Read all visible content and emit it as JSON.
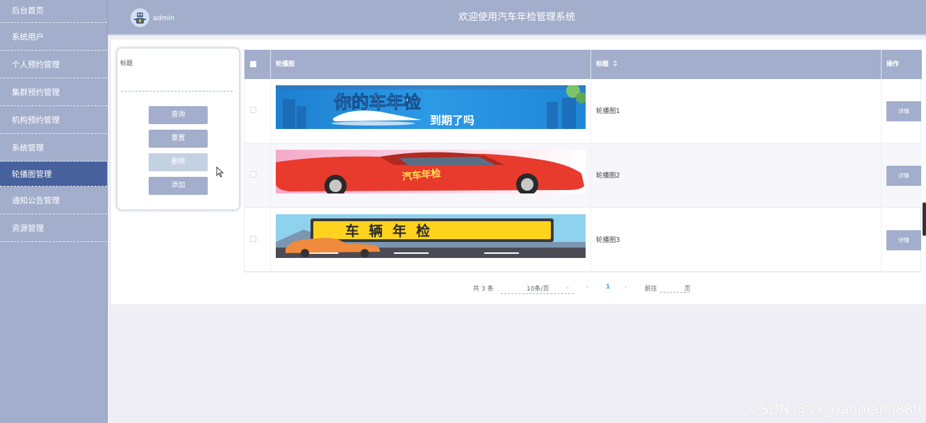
{
  "sidebar": {
    "items": [
      {
        "label": "后台首页"
      },
      {
        "label": "系统用户"
      },
      {
        "label": "个人预约管理"
      },
      {
        "label": "集群预约管理"
      },
      {
        "label": "机构预约管理"
      },
      {
        "label": "系统管理"
      },
      {
        "label": "轮播图管理"
      },
      {
        "label": "通知公告管理"
      },
      {
        "label": "资源管理"
      }
    ],
    "active": "轮播图管理"
  },
  "header": {
    "username": "admin",
    "title": "欢迎使用汽车年检管理系统"
  },
  "search": {
    "title_label": "标题",
    "title_value": "",
    "query_label": "查询",
    "reset_label": "重置",
    "delete_label": "删除",
    "add_label": "添加"
  },
  "table": {
    "columns": {
      "image": "轮播图",
      "title": "标题",
      "actions": "操作"
    },
    "rows": [
      {
        "banner_text_1": "你的车年检",
        "banner_text_2": "到期了吗",
        "title": "轮播图1",
        "action": "详情"
      },
      {
        "banner_text_1": "汽车年检",
        "title": "轮播图2",
        "action": "详情"
      },
      {
        "banner_text_1": "车辆年检",
        "title": "轮播图3",
        "action": "详情"
      }
    ]
  },
  "pagination": {
    "total": "共 3 条",
    "page_size": "10条/页",
    "current_page": "1",
    "goto_prefix": "前往",
    "goto_suffix": "页",
    "goto_value": ""
  },
  "watermark": "CSDN @vx_danpianji889",
  "colors": {
    "accent": "#a2aecb",
    "active_menu": "#46619b",
    "disabled_button": "#c4d1e2"
  }
}
